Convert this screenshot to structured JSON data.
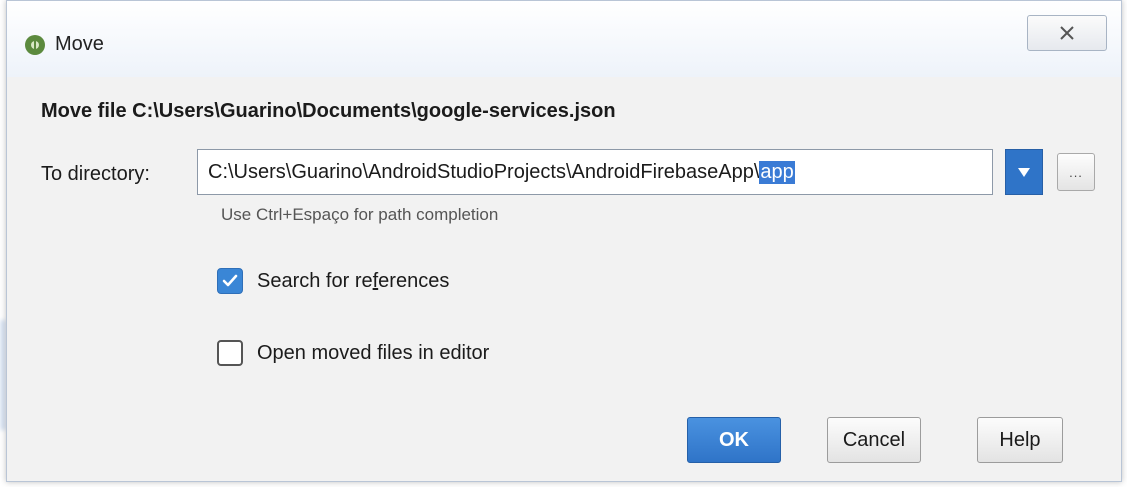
{
  "window": {
    "title": "Move"
  },
  "dialog": {
    "heading": "Move file C:\\Users\\Guarino\\Documents\\google-services.json",
    "directory_label": "To directory:",
    "directory_value_prefix": "C:\\Users\\Guarino\\AndroidStudioProjects\\AndroidFirebaseApp\\",
    "directory_value_selected": "app",
    "browse_label": "...",
    "hint": "Use Ctrl+Espaço for path completion",
    "search_refs": {
      "label_pre": "Search for re",
      "label_mnemonic": "f",
      "label_post": "erences",
      "checked": true
    },
    "open_moved": {
      "label": "Open moved files in editor",
      "checked": false
    }
  },
  "buttons": {
    "ok": "OK",
    "cancel": "Cancel",
    "help": "Help"
  },
  "colors": {
    "accent": "#2f74c8",
    "selection": "#3a7bd5"
  }
}
